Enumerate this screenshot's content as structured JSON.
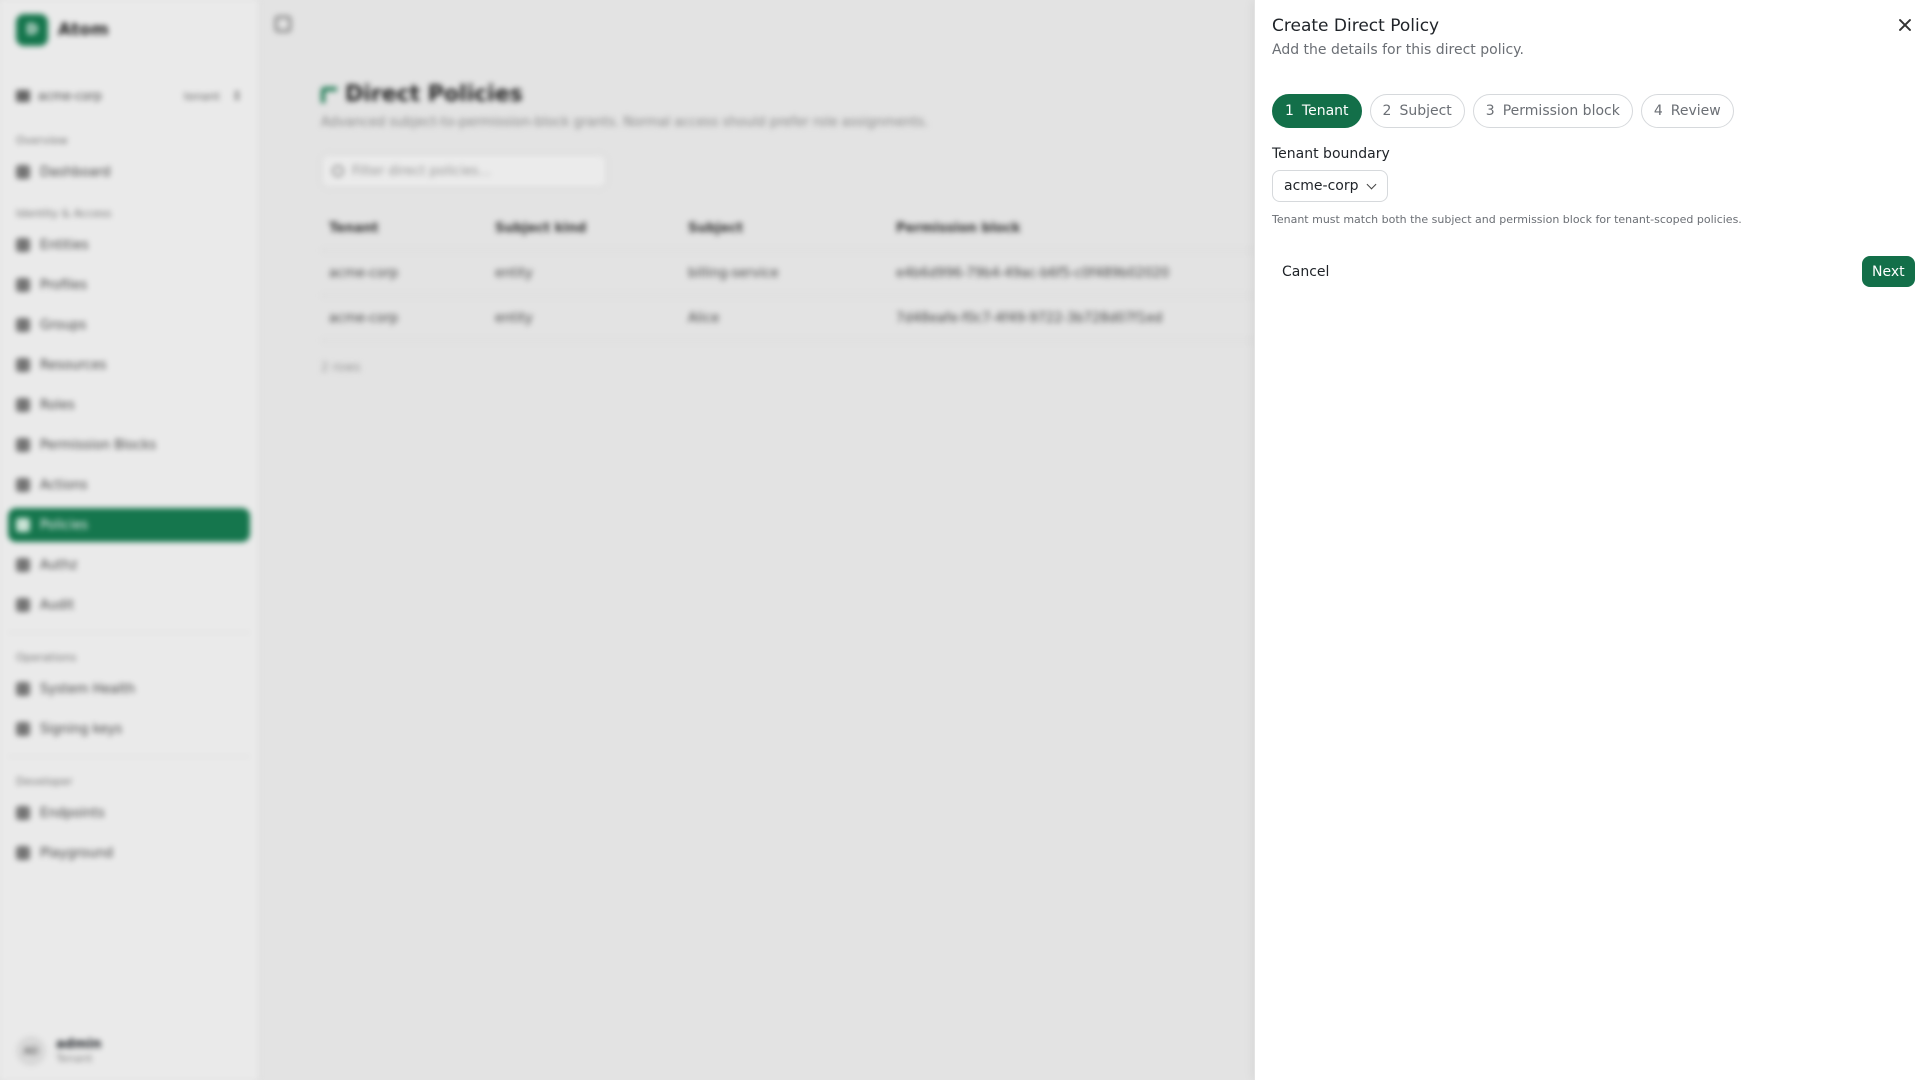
{
  "app": {
    "brand_initial": "D",
    "brand_name": "Atom",
    "tenant_name": "acme-corp",
    "tenant_tag": "tenant",
    "sections": {
      "overview": "Overview",
      "identity": "Identity & Access",
      "operations": "Operations",
      "developer": "Developer"
    },
    "nav": {
      "dashboard": "Dashboard",
      "entities": "Entities",
      "profiles": "Profiles",
      "groups": "Groups",
      "resources": "Resources",
      "roles": "Roles",
      "permission_blocks": "Permission Blocks",
      "actions": "Actions",
      "policies": "Policies",
      "authz": "Authz",
      "audit": "Audit",
      "system_health": "System Health",
      "signing_keys": "Signing keys",
      "endpoints": "Endpoints",
      "playground": "Playground"
    },
    "user": {
      "initials": "AD",
      "name": "admin",
      "role": "Tenant"
    }
  },
  "page": {
    "title": "Direct Policies",
    "subtitle": "Advanced subject-to-permission-block grants. Normal access should prefer role assignments.",
    "filter_placeholder": "Filter direct policies...",
    "columns": [
      "Tenant",
      "Subject kind",
      "Subject",
      "Permission block"
    ],
    "rows": [
      [
        "acme-corp",
        "entity",
        "billing-service",
        "e4b6d996-79b4-49ac-b6f5-c0f489b02020"
      ],
      [
        "acme-corp",
        "entity",
        "Alice",
        "7d48eafe-f0c7-4f49-9722-3b728d07f1ed"
      ]
    ],
    "rows_count": "2 rows"
  },
  "drawer": {
    "title": "Create Direct Policy",
    "description": "Add the details for this direct policy.",
    "steps": [
      {
        "num": "1",
        "label": "Tenant"
      },
      {
        "num": "2",
        "label": "Subject"
      },
      {
        "num": "3",
        "label": "Permission block"
      },
      {
        "num": "4",
        "label": "Review"
      }
    ],
    "active_step": 1,
    "field_label": "Tenant boundary",
    "field_value": "acme-corp",
    "field_help": "Tenant must match both the subject and permission block for tenant-scoped policies.",
    "cancel_label": "Cancel",
    "next_label": "Next"
  },
  "colors": {
    "accent": "#136f49"
  }
}
